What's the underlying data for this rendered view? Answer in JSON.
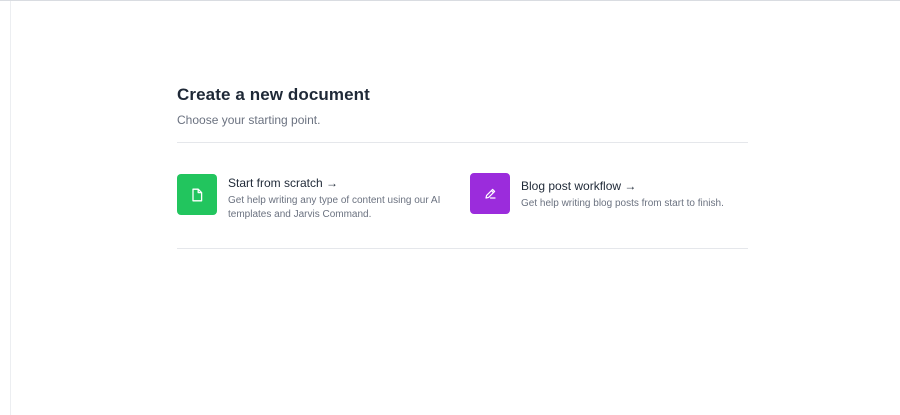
{
  "page": {
    "title": "Create a new document",
    "subtitle": "Choose your starting point."
  },
  "options": [
    {
      "title": "Start from scratch →",
      "description": "Get help writing any type of content using our AI templates and Jarvis Command.",
      "icon": "document-icon",
      "color": "#22c55e"
    },
    {
      "title": "Blog post workflow →",
      "description": "Get help writing blog posts from start to finish.",
      "icon": "pencil-icon",
      "color": "#9b2cdc"
    }
  ]
}
